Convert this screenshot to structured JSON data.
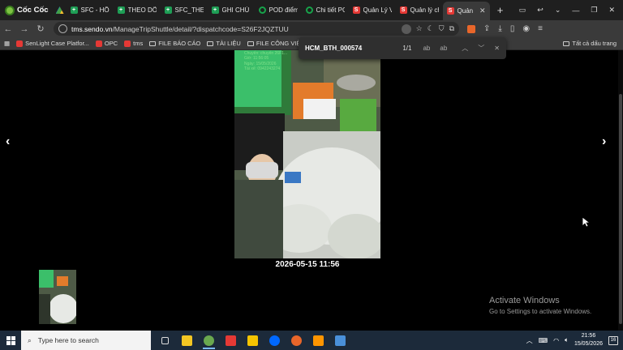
{
  "browser": {
    "brand": "Cốc Cốc",
    "tabs": [
      {
        "label": "SFC - HỒ",
        "icon": "sheets-icon"
      },
      {
        "label": "THEO DÕI",
        "icon": "sheets-icon"
      },
      {
        "label": "SFC_THEO",
        "icon": "sheets-icon"
      },
      {
        "label": "GHI CHÚ",
        "icon": "sheets-icon"
      },
      {
        "label": "POD điểm",
        "icon": "green-ring-icon"
      },
      {
        "label": "Chi tiết PC",
        "icon": "green-ring-icon"
      },
      {
        "label": "Quản Lý V",
        "icon": "sendo-icon"
      },
      {
        "label": "Quản lý ch",
        "icon": "sendo-icon"
      },
      {
        "label": "Quản",
        "icon": "sendo-icon",
        "active": true
      }
    ],
    "url_host": "tms.sendo.vn",
    "url_path": "/ManageTripShuttle/detail/?dispatchcode=S26F2JQZTUU"
  },
  "bookmarks": {
    "items": [
      {
        "label": "SenLight Case Platfor...",
        "icon": "sendo-icon"
      },
      {
        "label": "OPC",
        "icon": "sendo-icon"
      },
      {
        "label": "tms",
        "icon": "sendo-icon"
      },
      {
        "label": "FILE BÁO CÁO",
        "icon": "folder-icon"
      },
      {
        "label": "TÀI LIỆU",
        "icon": "folder-icon"
      },
      {
        "label": "FILE CÔNG VIỆC",
        "icon": "folder-icon"
      }
    ],
    "all": "Tất cả dấu trang"
  },
  "find": {
    "query": "HCM_BTH_000574",
    "count": "1/1",
    "match_case": "ab",
    "whole_word": "ab"
  },
  "viewer": {
    "prev": "‹",
    "next": "›",
    "photo_overlay": [
      "Chuyến: chuyến 26F1...",
      "Giờ: 11:56:05",
      "Ngày: 15/05/2026",
      "Tài xế: 0942243274"
    ],
    "caption": "2026-05-15 11:56"
  },
  "watermark": {
    "title": "Activate Windows",
    "subtitle": "Go to Settings to activate Windows."
  },
  "taskbar": {
    "search_placeholder": "Type here to search",
    "time": "21:56",
    "date": "15/05/2026",
    "notifications": "16",
    "apps": [
      {
        "name": "task-view",
        "color": "#dddddd"
      },
      {
        "name": "file-explorer",
        "color": "#f3c623"
      },
      {
        "name": "coccoc",
        "color": "#6aa84f",
        "active": true
      },
      {
        "name": "wps",
        "color": "#e53935"
      },
      {
        "name": "sticky-notes",
        "color": "#f5c400"
      },
      {
        "name": "zalo",
        "color": "#0068ff"
      },
      {
        "name": "app-orange",
        "color": "#e8662a"
      },
      {
        "name": "app-firefox",
        "color": "#ff9500"
      },
      {
        "name": "app-blue",
        "color": "#4a90d9"
      }
    ]
  }
}
